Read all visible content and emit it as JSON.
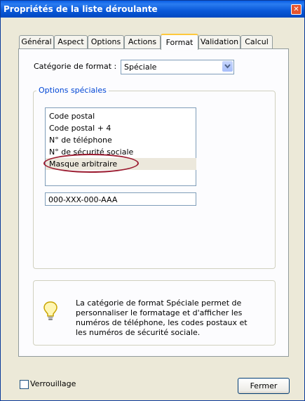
{
  "window": {
    "title": "Propriétés de la liste déroulante",
    "close_glyph": "✕"
  },
  "tabs": [
    {
      "label": "Général",
      "active": false
    },
    {
      "label": "Aspect",
      "active": false
    },
    {
      "label": "Options",
      "active": false
    },
    {
      "label": "Actions",
      "active": false
    },
    {
      "label": "Format",
      "active": true
    },
    {
      "label": "Validation",
      "active": false
    },
    {
      "label": "Calcul",
      "active": false
    }
  ],
  "format": {
    "category_label": "Catégorie de format :",
    "category_value": "Spéciale",
    "group_title": "Options spéciales",
    "options": [
      "Code postal",
      "Code postal + 4",
      "N° de téléphone",
      "N° de sécurité sociale",
      "Masque arbitraire"
    ],
    "selected_option": "Masque arbitraire",
    "mask_value": "000-XXX-000-AAA",
    "info_text": "La catégorie de format Spéciale permet de personnaliser le formatage et d'afficher les numéros de téléphone, les codes postaux et les numéros de sécurité sociale."
  },
  "footer": {
    "lock_label": "Verrouillage",
    "lock_checked": false,
    "close_button": "Fermer"
  },
  "colors": {
    "titlebar": "#0a58d8",
    "highlight_ellipse": "#9b1b30",
    "group_title": "#0046d5"
  },
  "icons": {
    "info": "lightbulb-icon",
    "dropdown": "chevron-down-icon",
    "close": "close-icon"
  }
}
